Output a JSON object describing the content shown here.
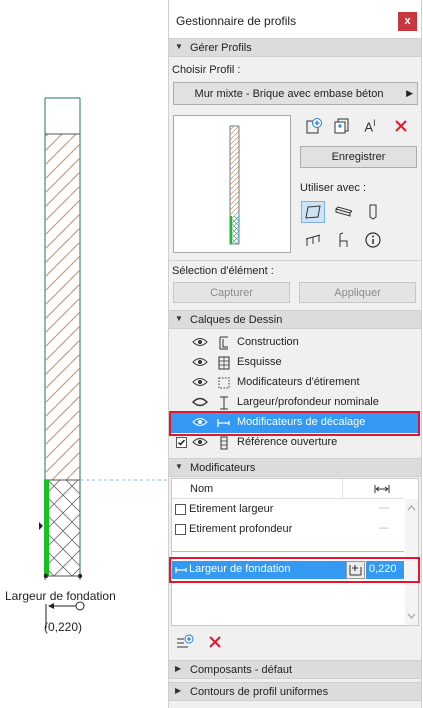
{
  "canvas": {
    "label": "Largeur de fondation",
    "value": "(0,220)"
  },
  "panel": {
    "title": "Gestionnaire de profils",
    "close": "x"
  },
  "manage": {
    "section": "Gérer Profils",
    "choose_label": "Choisir Profil :",
    "profile_value": "Mur mixte - Brique avec embase béton",
    "save_label": "Enregistrer",
    "use_with_label": "Utiliser avec :"
  },
  "element_selection": {
    "label": "Sélection d'élément :",
    "capture": "Capturer",
    "apply": "Appliquer"
  },
  "layers": {
    "section": "Calques de Dessin",
    "items": [
      {
        "label": "Construction"
      },
      {
        "label": "Esquisse"
      },
      {
        "label": "Modificateurs d'étirement"
      },
      {
        "label": "Largeur/profondeur nominale"
      },
      {
        "label": "Modificateurs de décalage"
      },
      {
        "label": "Référence ouverture"
      }
    ]
  },
  "modifiers": {
    "section": "Modificateurs",
    "col_name": "Nom",
    "rows": [
      {
        "label": "Etirement largeur",
        "value": "---"
      },
      {
        "label": "Etirement profondeur",
        "value": "---"
      }
    ],
    "selected": {
      "label": "Largeur de fondation",
      "value": "0,220"
    }
  },
  "bottom_sections": [
    {
      "label": "Composants - défaut"
    },
    {
      "label": "Contours de profil uniformes"
    }
  ],
  "colors": {
    "accent": "#3399f3",
    "highlight_box": "#e2162f",
    "close": "#c6373f"
  }
}
